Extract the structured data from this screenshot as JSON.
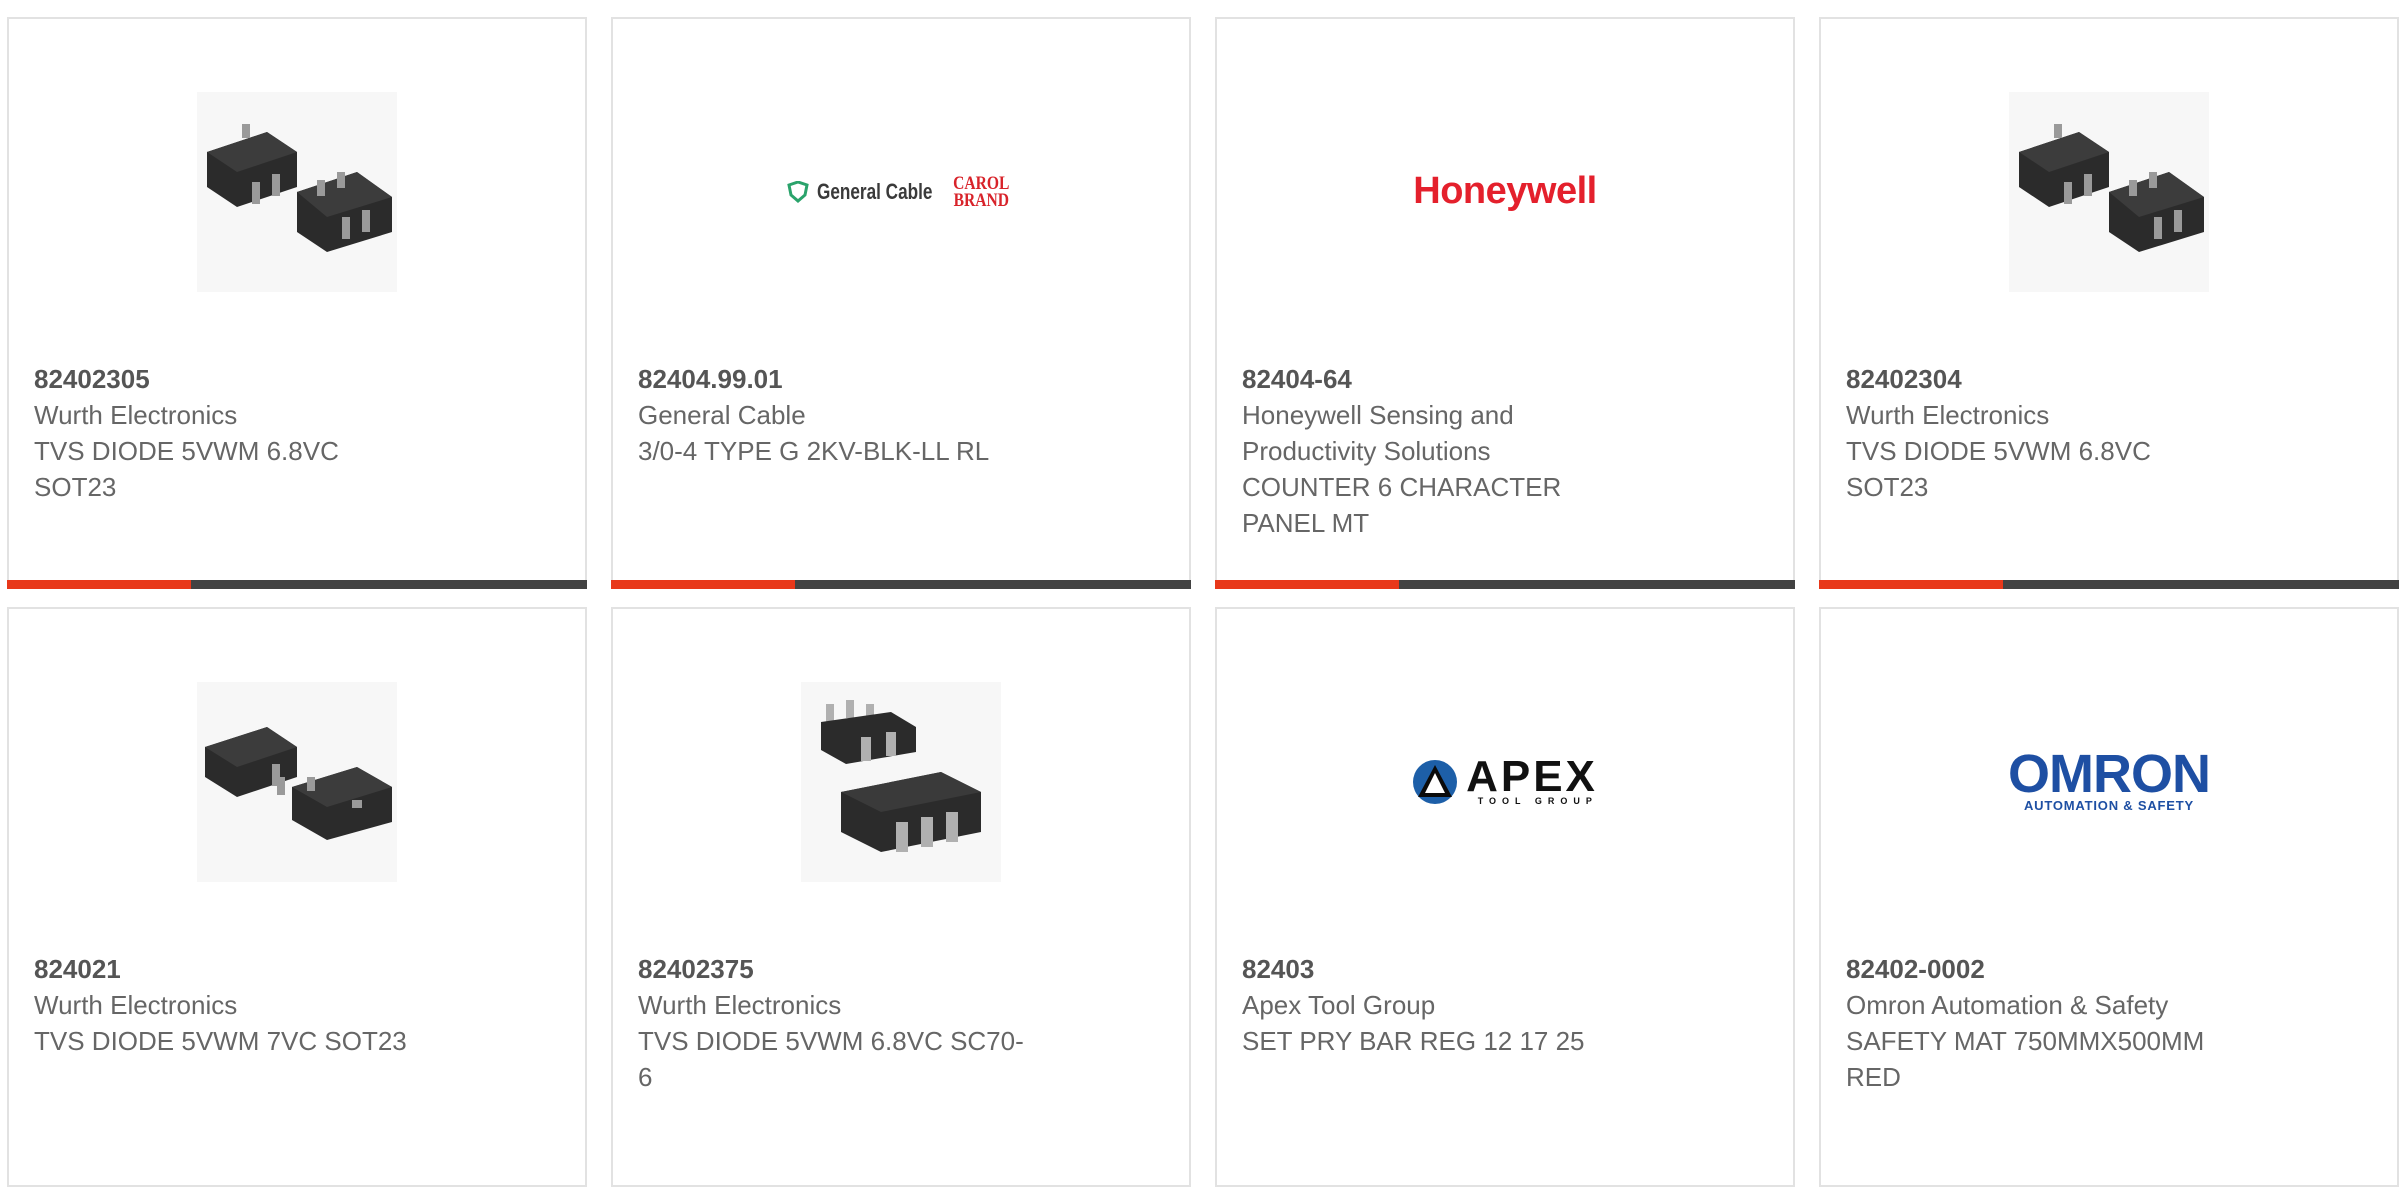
{
  "products": [
    {
      "part": "82402305",
      "maker": "Wurth Electronics",
      "desc": [
        "TVS DIODE 5VWM 6.8VC",
        "SOT23"
      ],
      "image": "chip-sot23-icon"
    },
    {
      "part": "82404.99.01",
      "maker": "General Cable",
      "desc": [
        "3/0-4 TYPE G 2KV-BLK-LL RL"
      ],
      "image": "general-cable-logo",
      "logo_text": "General Cable",
      "logo_text2": "CAROL",
      "logo_text3": "BRAND"
    },
    {
      "part": "82404-64",
      "maker_lines": [
        "Honeywell Sensing and",
        "Productivity Solutions"
      ],
      "desc": [
        "COUNTER 6 CHARACTER",
        "PANEL MT"
      ],
      "image": "honeywell-logo",
      "logo_text": "Honeywell"
    },
    {
      "part": "82402304",
      "maker": "Wurth Electronics",
      "desc": [
        "TVS DIODE 5VWM 6.8VC",
        "SOT23"
      ],
      "image": "chip-sot23-icon"
    },
    {
      "part": "824021",
      "maker": "Wurth Electronics",
      "desc": [
        "TVS DIODE 5VWM 7VC SOT23"
      ],
      "image": "chip-sot23-3pin-icon"
    },
    {
      "part": "82402375",
      "maker": "Wurth Electronics",
      "desc": [
        "TVS DIODE 5VWM 6.8VC SC70-",
        "6"
      ],
      "image": "chip-sc70-icon"
    },
    {
      "part": "82403",
      "maker": "Apex Tool Group",
      "desc": [
        "SET PRY BAR REG 12 17 25"
      ],
      "image": "apex-logo",
      "logo_text": "APEX",
      "logo_sub": "TOOL GROUP"
    },
    {
      "part": "82402-0002",
      "maker": "Omron Automation & Safety",
      "desc": [
        "SAFETY MAT 750MMX500MM",
        "RED"
      ],
      "image": "omron-logo",
      "logo_text": "OMRON",
      "logo_sub": "AUTOMATION & SAFETY"
    }
  ],
  "colors": {
    "accent": "#e8381a",
    "bar": "#424242",
    "honeywell": "#e4202c",
    "omron": "#1e4fa3",
    "carol": "#d8232a"
  }
}
